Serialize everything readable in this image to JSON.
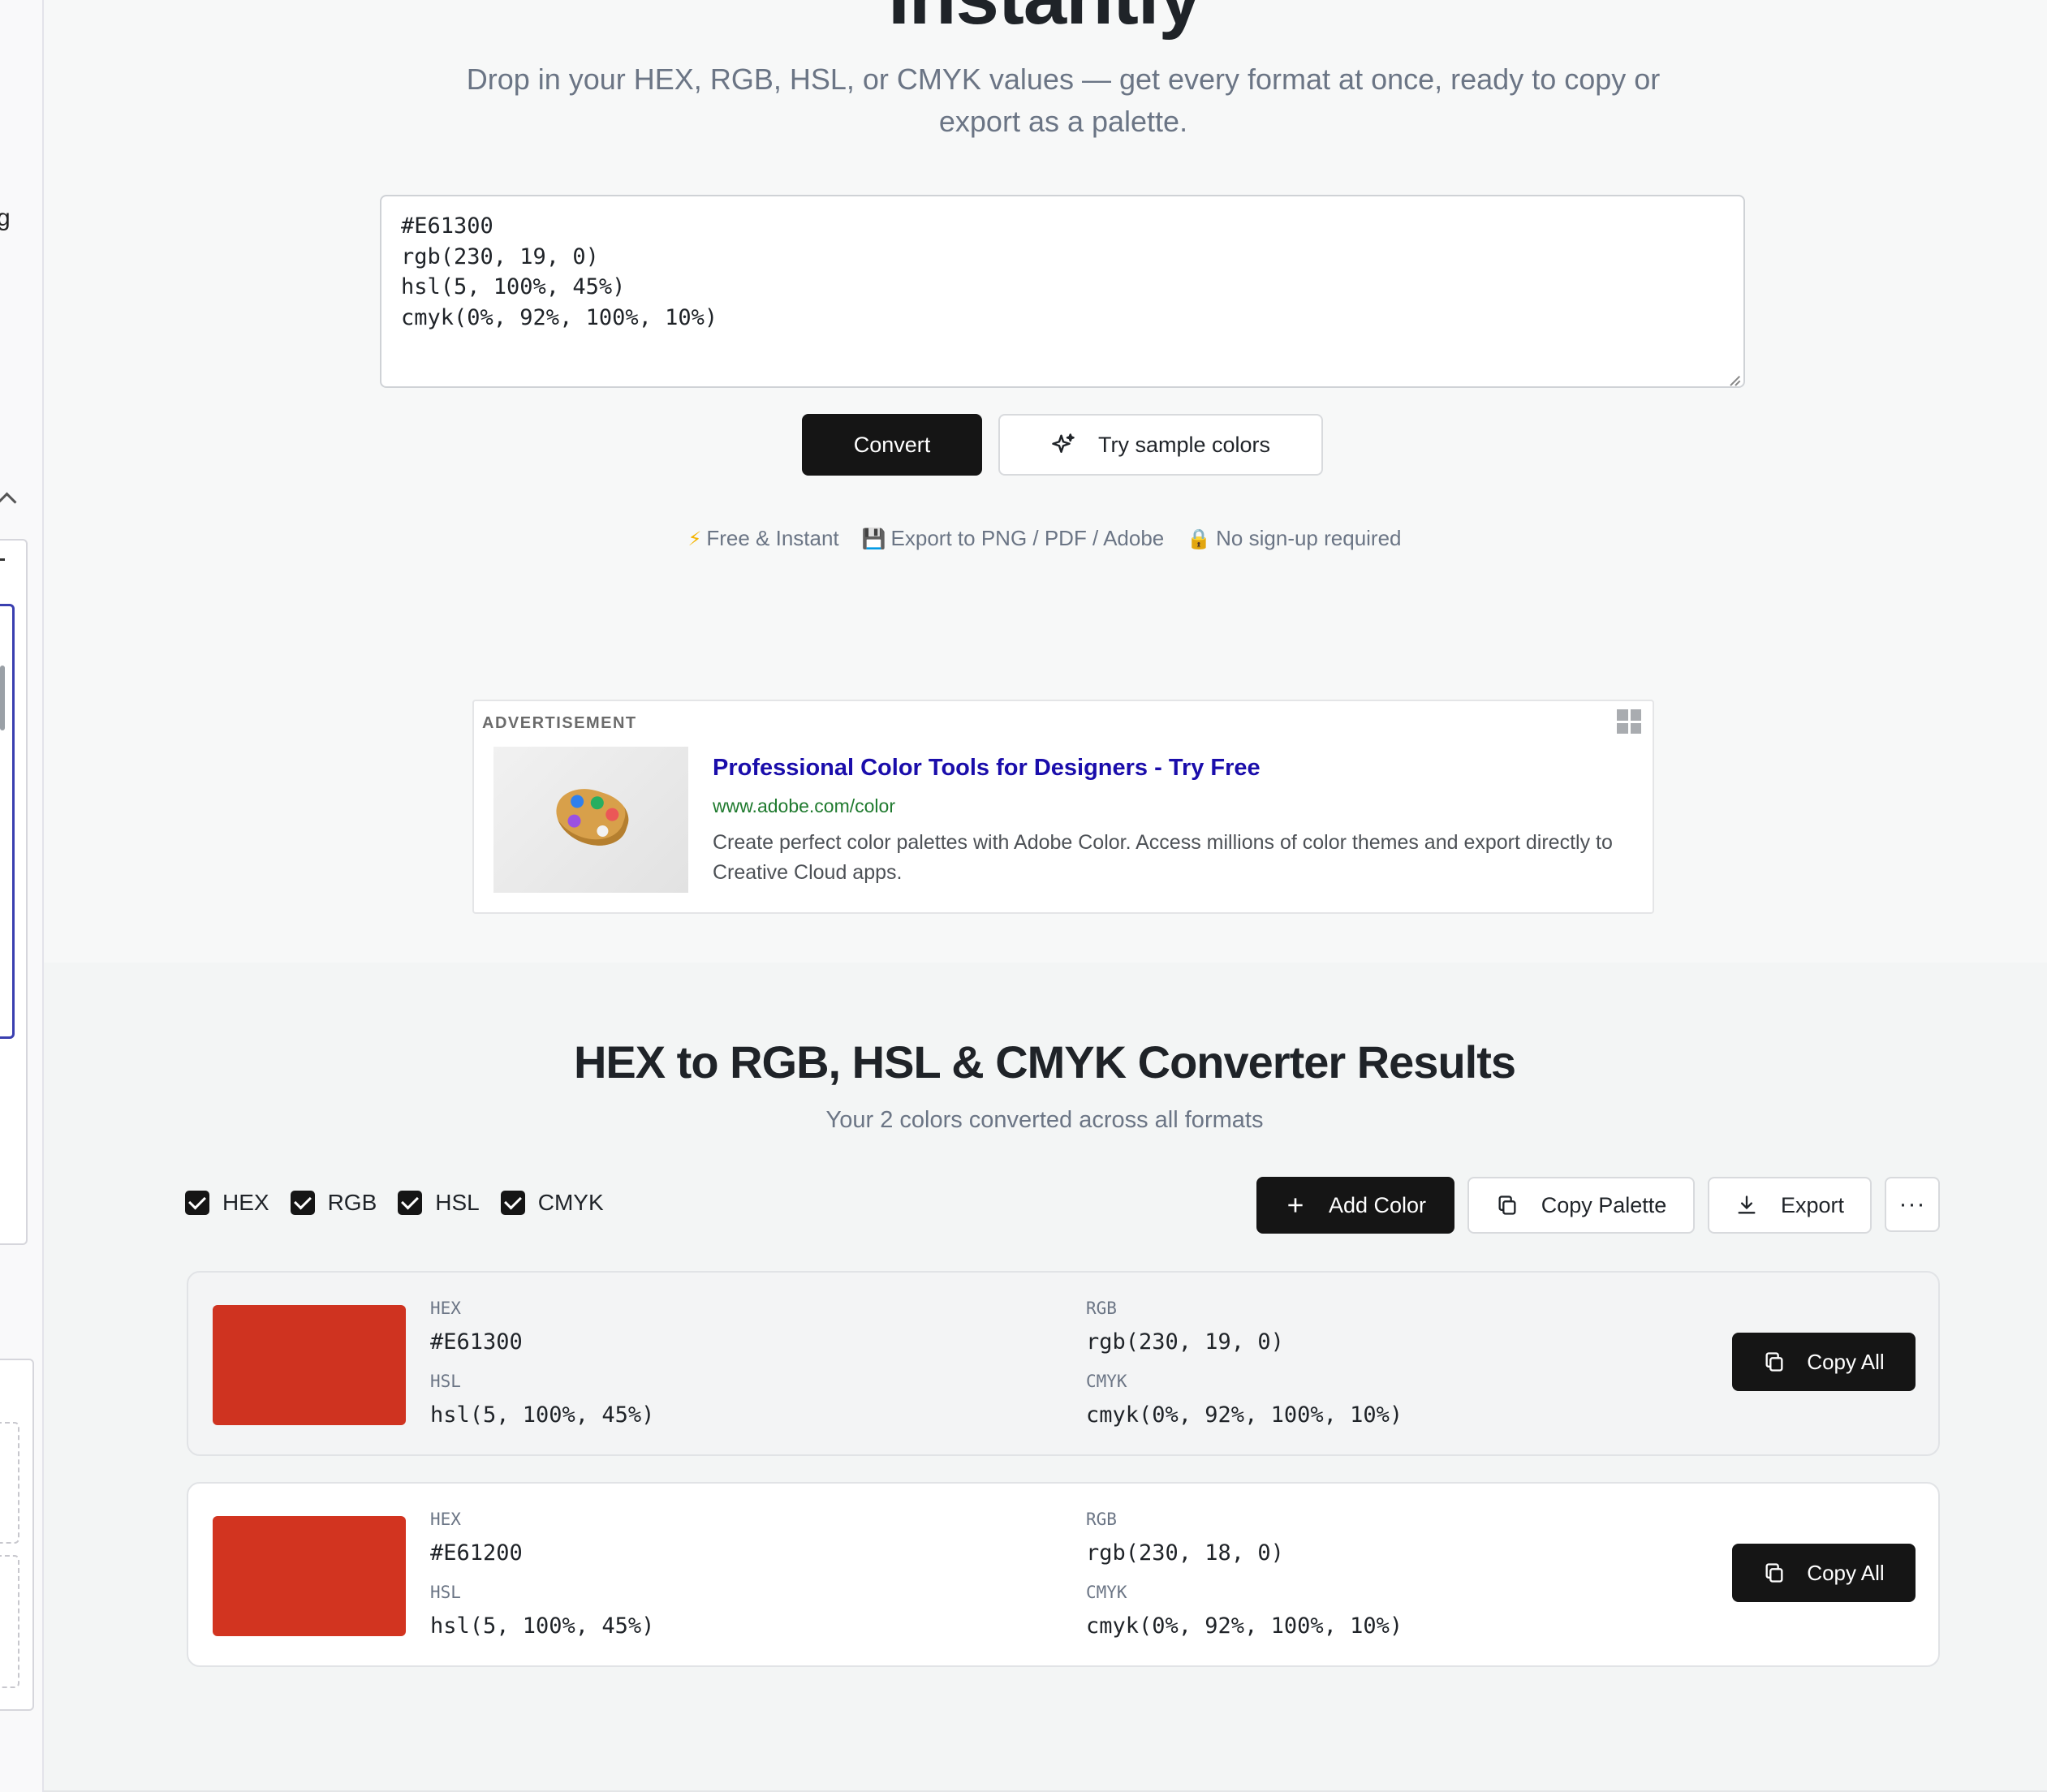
{
  "hero": {
    "title": "Instantly",
    "subtitle": "Drop in your HEX, RGB, HSL, or CMYK values — get every format at once, ready to copy or export as a palette.",
    "input_value": "#E61300\nrgb(230, 19, 0)\nhsl(5, 100%, 45%)\ncmyk(0%, 92%, 100%, 10%)",
    "convert_label": "Convert",
    "sample_label": "Try sample colors",
    "features": [
      {
        "icon": "lightning-icon",
        "emoji": "⚡",
        "label": "Free & Instant"
      },
      {
        "icon": "floppy-disk-icon",
        "emoji": "💾",
        "label": "Export to PNG / PDF / Adobe"
      },
      {
        "icon": "lock-icon",
        "emoji": "🔒",
        "label": "No sign-up required"
      }
    ]
  },
  "ad": {
    "label": "ADVERTISEMENT",
    "title": "Professional Color Tools for Designers - Try Free",
    "url": "www.adobe.com/color",
    "description": "Create perfect color palettes with Adobe Color. Access millions of color themes and export directly to Creative Cloud apps."
  },
  "results": {
    "title": "HEX to RGB, HSL & CMYK Converter Results",
    "subtitle": "Your 2 colors converted across all formats",
    "toggles": [
      {
        "label": "HEX",
        "checked": true
      },
      {
        "label": "RGB",
        "checked": true
      },
      {
        "label": "HSL",
        "checked": true
      },
      {
        "label": "CMYK",
        "checked": true
      }
    ],
    "add_color_label": "Add Color",
    "copy_palette_label": "Copy Palette",
    "export_label": "Export",
    "more_label": "···",
    "copy_all_label": "Copy All",
    "colors": [
      {
        "swatch": "#CF3320",
        "hex_label": "HEX",
        "hex": "#E61300",
        "rgb_label": "RGB",
        "rgb": "rgb(230, 19, 0)",
        "hsl_label": "HSL",
        "hsl": "hsl(5, 100%, 45%)",
        "cmyk_label": "CMYK",
        "cmyk": "cmyk(0%, 92%, 100%, 10%)"
      },
      {
        "swatch": "#D23420",
        "hex_label": "HEX",
        "hex": "#E61200",
        "rgb_label": "RGB",
        "rgb": "rgb(230, 18, 0)",
        "hsl_label": "HSL",
        "hsl": "hsl(5, 100%, 45%)",
        "cmyk_label": "CMYK",
        "cmyk": "cmyk(0%, 92%, 100%, 10%)"
      }
    ]
  },
  "colors": {
    "primary_button": "#151515",
    "ad_title": "#1a0dab",
    "ad_url": "#1f7a2e",
    "muted_text": "#6b7585"
  }
}
